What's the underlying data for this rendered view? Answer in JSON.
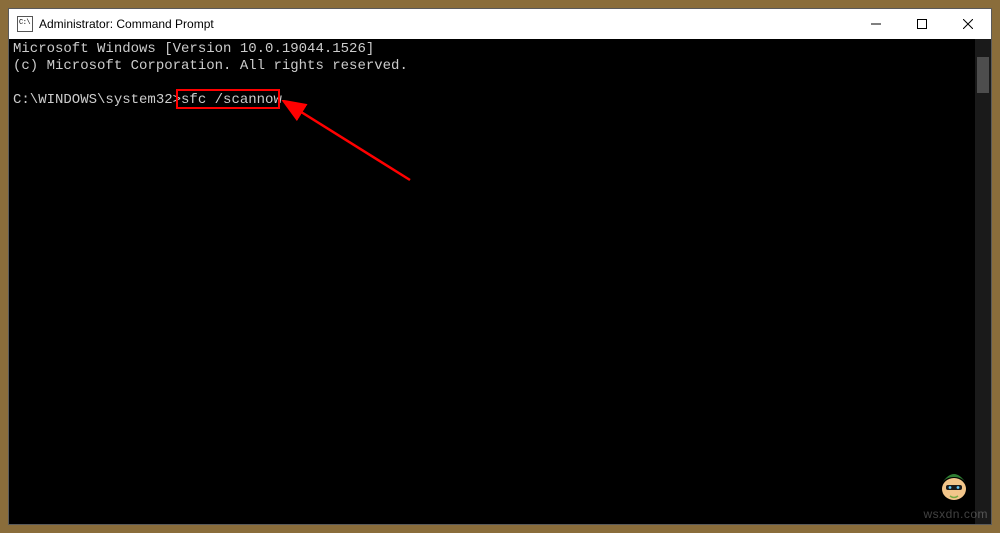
{
  "window": {
    "title": "Administrator: Command Prompt",
    "icon_label": "cmd-icon"
  },
  "terminal": {
    "line1": "Microsoft Windows [Version 10.0.19044.1526]",
    "line2": "(c) Microsoft Corporation. All rights reserved.",
    "blank": "",
    "prompt": "C:\\WINDOWS\\system32>",
    "command": "sfc /scannow"
  },
  "annotation": {
    "highlight_target": "command",
    "arrow_color": "#ff0000"
  },
  "watermark": "wsxdn.com"
}
